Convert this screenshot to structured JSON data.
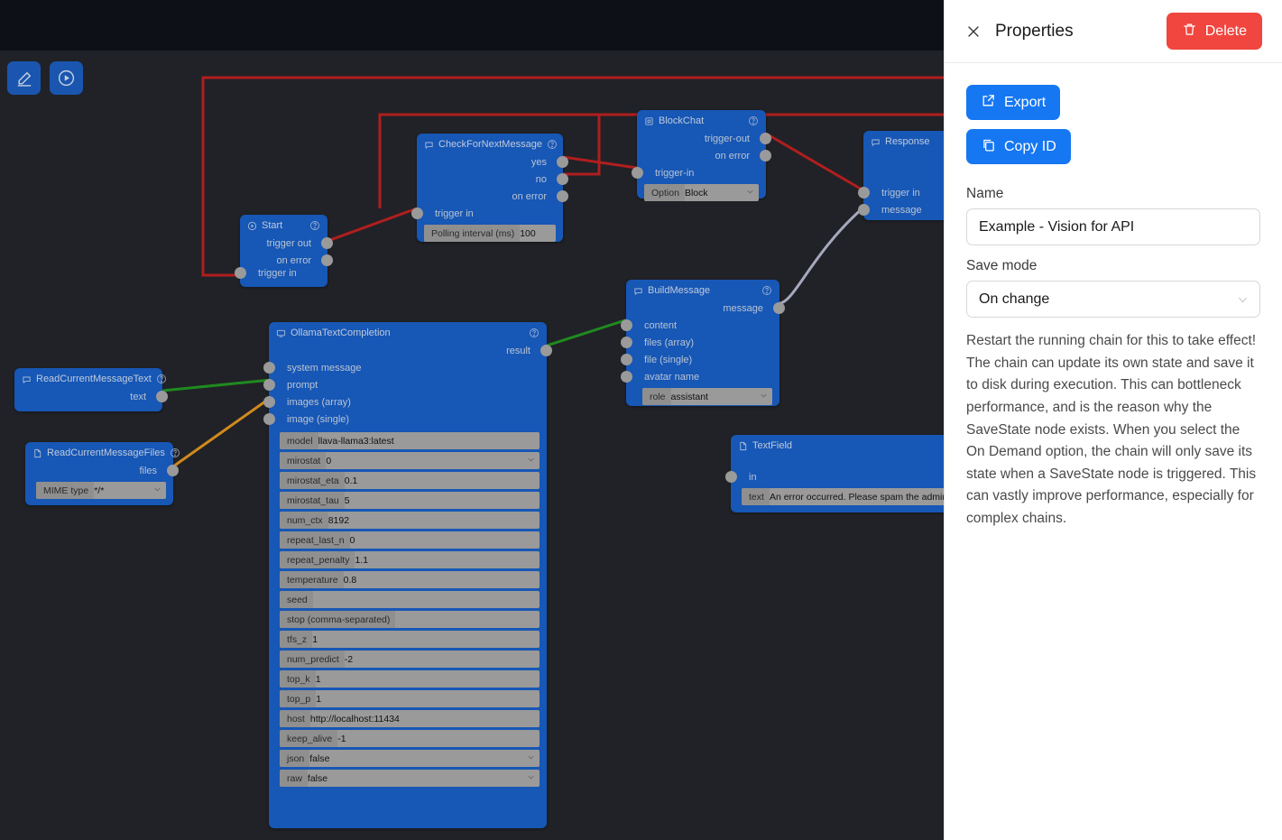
{
  "colors": {
    "canvas_bg": "#212227",
    "node_blue": "#1757b5",
    "accent_blue": "#1677f2",
    "danger_red": "#f0463f",
    "edge_red": "#c02020",
    "edge_green": "#1f8a1f",
    "edge_orange": "#cf8a1d",
    "edge_gray": "#a6a9bd",
    "selection_red": "#b01e1e",
    "port_gray": "#9a9a9a",
    "field_gray": "#9a9a9a"
  },
  "toolbar": {
    "buttons": [
      {
        "name": "edit-mode-button",
        "icon": "pencil-icon"
      },
      {
        "name": "run-chain-button",
        "icon": "play-circle-icon"
      }
    ]
  },
  "panel": {
    "title": "Properties",
    "close_icon": "close-icon",
    "delete_label": "Delete",
    "delete_icon": "trash-icon",
    "export_label": "Export",
    "export_icon": "external-link-icon",
    "copy_id_label": "Copy ID",
    "copy_id_icon": "copy-icon",
    "name_label": "Name",
    "name_value": "Example - Vision for API",
    "name_placeholder": "Name",
    "save_mode_label": "Save mode",
    "save_mode_value": "On change",
    "save_mode_options": [
      "On change",
      "On Demand"
    ],
    "help_text": "Restart the running chain for this to take effect! The chain can update its own state and save it to disk during execution. This can bottleneck performance, and is the reason why the SaveState node exists. When you select the On Demand option, the chain will only save its state when a SaveState node is triggered. This can vastly improve performance, especially for complex chains."
  },
  "nodes": {
    "start": {
      "title": "Start",
      "icon": "play-node-icon",
      "help_icon": "help-icon",
      "outputs": [
        "trigger out",
        "on error"
      ],
      "inputs": [
        "trigger in"
      ]
    },
    "check_for_next_message": {
      "title": "CheckForNextMessage",
      "icon": "chat-node-icon",
      "help_icon": "help-icon",
      "outputs": [
        "yes",
        "no",
        "on error"
      ],
      "inputs": [
        "trigger in"
      ],
      "fields": [
        {
          "key": "Polling interval (ms)",
          "value": "100",
          "type": "text"
        }
      ]
    },
    "block_chat": {
      "title": "BlockChat",
      "icon": "block-node-icon",
      "help_icon": "help-icon",
      "outputs": [
        "trigger-out",
        "on error"
      ],
      "inputs": [
        "trigger-in"
      ],
      "fields": [
        {
          "key": "Option",
          "value": "Block",
          "type": "select"
        }
      ]
    },
    "response": {
      "title": "Response",
      "icon": "chat-node-icon",
      "help_icon": "help-icon",
      "outputs": [],
      "inputs": [
        "trigger in",
        "message"
      ],
      "fields": []
    },
    "build_message": {
      "title": "BuildMessage",
      "icon": "chat-node-icon",
      "help_icon": "help-icon",
      "outputs": [
        "message"
      ],
      "inputs": [
        "content",
        "files (array)",
        "file (single)",
        "avatar name"
      ],
      "fields": [
        {
          "key": "role",
          "value": "assistant",
          "type": "select"
        }
      ]
    },
    "read_current_message_text": {
      "title": "ReadCurrentMessageText",
      "icon": "chat-node-icon",
      "help_icon": "help-icon",
      "outputs": [
        "text"
      ],
      "inputs": [],
      "fields": []
    },
    "read_current_message_files": {
      "title": "ReadCurrentMessageFiles",
      "icon": "file-node-icon",
      "help_icon": "help-icon",
      "outputs": [
        "files"
      ],
      "inputs": [],
      "fields": [
        {
          "key": "MIME type",
          "value": "*/*",
          "type": "select"
        }
      ]
    },
    "ollama_text_completion": {
      "title": "OllamaTextCompletion",
      "icon": "monitor-node-icon",
      "help_icon": "help-icon",
      "outputs": [
        "result"
      ],
      "inputs": [
        "system message",
        "prompt",
        "images (array)",
        "image (single)"
      ],
      "fields": [
        {
          "key": "model",
          "value": "llava-llama3:latest",
          "type": "text"
        },
        {
          "key": "mirostat",
          "value": "0",
          "type": "select"
        },
        {
          "key": "mirostat_eta",
          "value": "0.1",
          "type": "text"
        },
        {
          "key": "mirostat_tau",
          "value": "5",
          "type": "text"
        },
        {
          "key": "num_ctx",
          "value": "8192",
          "type": "text"
        },
        {
          "key": "repeat_last_n",
          "value": "0",
          "type": "text"
        },
        {
          "key": "repeat_penalty",
          "value": "1.1",
          "type": "text"
        },
        {
          "key": "temperature",
          "value": "0.8",
          "type": "text"
        },
        {
          "key": "seed",
          "value": "",
          "type": "text"
        },
        {
          "key": "stop (comma-separated)",
          "value": "",
          "type": "text"
        },
        {
          "key": "tfs_z",
          "value": "1",
          "type": "text"
        },
        {
          "key": "num_predict",
          "value": "-2",
          "type": "text"
        },
        {
          "key": "top_k",
          "value": "1",
          "type": "text"
        },
        {
          "key": "top_p",
          "value": "1",
          "type": "text"
        },
        {
          "key": "host",
          "value": "http://localhost:11434",
          "type": "text"
        },
        {
          "key": "keep_alive",
          "value": "-1",
          "type": "text"
        },
        {
          "key": "json",
          "value": "false",
          "type": "select"
        },
        {
          "key": "raw",
          "value": "false",
          "type": "select"
        }
      ]
    },
    "text_field": {
      "title": "TextField",
      "icon": "file-node-icon",
      "help_icon": "help-icon",
      "outputs": [],
      "inputs": [
        "in"
      ],
      "fields": [
        {
          "key": "text",
          "value": "An error occurred. Please spam the admin.",
          "type": "text"
        }
      ]
    }
  }
}
